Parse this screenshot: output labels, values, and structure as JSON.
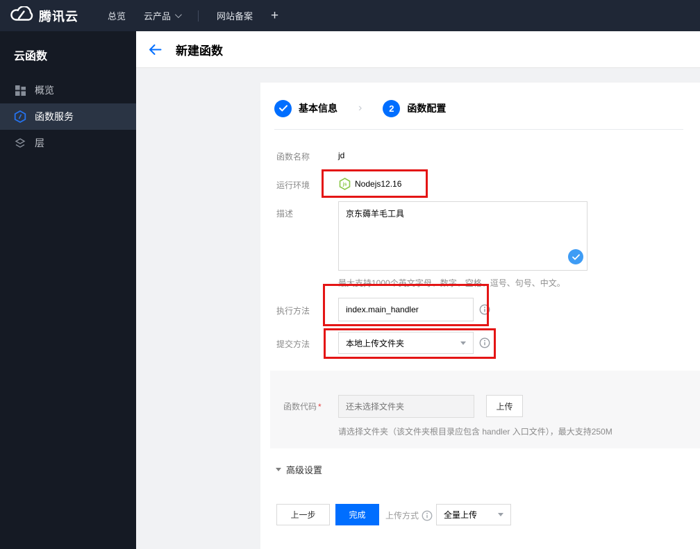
{
  "topnav": {
    "brand": "腾讯云",
    "items": [
      {
        "label": "总览"
      },
      {
        "label": "云产品"
      },
      {
        "label": "网站备案"
      },
      {
        "label": "+"
      }
    ]
  },
  "sidebar": {
    "title": "云函数",
    "items": [
      {
        "label": "概览",
        "icon": "grid-icon",
        "active": false
      },
      {
        "label": "函数服务",
        "icon": "function-hexagon-icon",
        "active": true
      },
      {
        "label": "层",
        "icon": "layers-icon",
        "active": false
      }
    ]
  },
  "header": {
    "title": "新建函数",
    "back_icon": "arrow-left-icon"
  },
  "steps": [
    {
      "label": "基本信息",
      "state": "done",
      "icon": "check-icon"
    },
    {
      "label": "函数配置",
      "state": "current",
      "number": "2"
    }
  ],
  "form": {
    "function_name": {
      "label": "函数名称",
      "value": "jd"
    },
    "runtime": {
      "label": "运行环境",
      "value": "Nodejs12.16",
      "icon": "nodejs-icon"
    },
    "description": {
      "label": "描述",
      "value": "京东薅羊毛工具",
      "helper": "最大支持1000个英文字母、数字、空格、逗号、句号、中文。",
      "valid_icon": "check-badge-icon"
    },
    "handler": {
      "label": "执行方法",
      "value": "index.main_handler",
      "info_icon": "info-icon"
    },
    "submit_method": {
      "label": "提交方法",
      "value": "本地上传文件夹",
      "info_icon": "info-icon"
    },
    "function_code": {
      "label": "函数代码",
      "required_mark": "*",
      "placeholder": "还未选择文件夹",
      "upload_button": "上传",
      "helper": "请选择文件夹（该文件夹根目录应包含 handler 入口文件），最大支持250M"
    }
  },
  "advanced": {
    "label": "高级设置"
  },
  "footer": {
    "prev_button": "上一步",
    "finish_button": "完成",
    "upload_mode_label": "上传方式",
    "upload_mode_value": "全量上传"
  },
  "colors": {
    "accent_blue": "#006eff",
    "check_badge_blue": "#3e9cf5",
    "node_green": "#8cc84b",
    "annotation_red": "#e41515",
    "topnav_bg": "#1f2736",
    "sidebar_bg": "#151a24",
    "sidebar_active_bg": "#2a3444"
  }
}
